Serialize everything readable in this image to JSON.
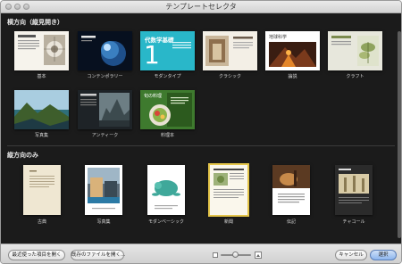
{
  "window": {
    "title": "テンプレートセレクタ"
  },
  "sections": [
    {
      "title": "横方向（縦見開き）",
      "templates": [
        {
          "label": "基本",
          "selected": false
        },
        {
          "label": "コンテンポラリー",
          "selected": false
        },
        {
          "label": "モダンタイプ",
          "selected": false,
          "thumb_text": "代数学基礎",
          "thumb_big": "1"
        },
        {
          "label": "クラシック",
          "selected": false
        },
        {
          "label": "論説",
          "selected": false,
          "thumb_text": "地球科学"
        },
        {
          "label": "クラフト",
          "selected": false
        },
        {
          "label": "写真集",
          "selected": false
        },
        {
          "label": "アンティーク",
          "selected": false
        },
        {
          "label": "料理本",
          "selected": false,
          "thumb_text": "旬の料理"
        }
      ]
    },
    {
      "title": "縦方向のみ",
      "templates": [
        {
          "label": "古典",
          "selected": false
        },
        {
          "label": "写真集",
          "selected": false
        },
        {
          "label": "モダンベーシック",
          "selected": false
        },
        {
          "label": "新聞",
          "selected": true
        },
        {
          "label": "伝記",
          "selected": false
        },
        {
          "label": "チャコール",
          "selected": false
        }
      ]
    }
  ],
  "footer": {
    "open_recent": "最近使った項目を開く",
    "open_existing": "既存のファイルを開く...",
    "cancel": "キャンセル",
    "choose": "選択"
  },
  "colors": {
    "selection": "#e4c54a",
    "accent": "#29b7c9"
  }
}
